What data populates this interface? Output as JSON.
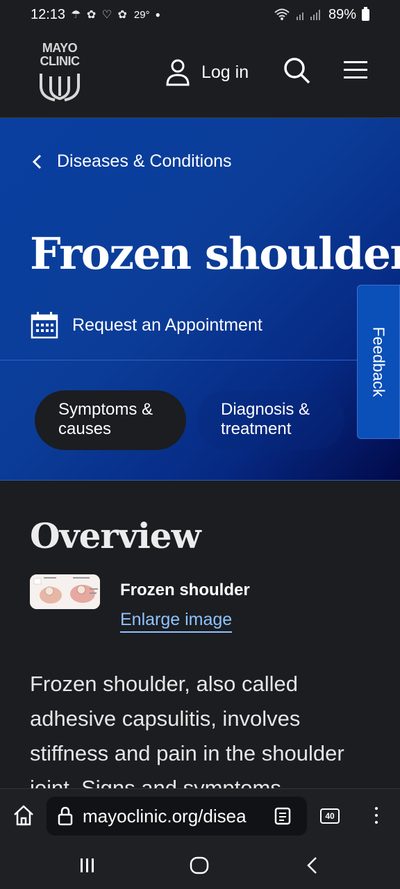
{
  "status_bar": {
    "time": "12:13",
    "temperature": "29°",
    "battery": "89%"
  },
  "header": {
    "logo_line1": "MAYO",
    "logo_line2": "CLINIC",
    "login_label": "Log in"
  },
  "hero": {
    "breadcrumb": "Diseases & Conditions",
    "title": "Frozen shoulder",
    "appointment_label": "Request an Appointment",
    "tabs": [
      {
        "line1": "Symptoms &",
        "line2": "causes"
      },
      {
        "line1": "Diagnosis &",
        "line2": "treatment"
      }
    ],
    "feedback_label": "Feedback"
  },
  "content": {
    "heading": "Overview",
    "figure_title": "Frozen shoulder",
    "enlarge_label": "Enlarge image",
    "body": "Frozen shoulder, also called adhesive capsulitis, involves stiffness and pain in the shoulder joint. Signs and symptoms"
  },
  "browser": {
    "url": "mayoclinic.org/disea",
    "tab_count": "40"
  },
  "colors": {
    "hero_blue": "#0b3d98",
    "link_blue": "#8ec3ff",
    "background": "#1c1d21"
  }
}
